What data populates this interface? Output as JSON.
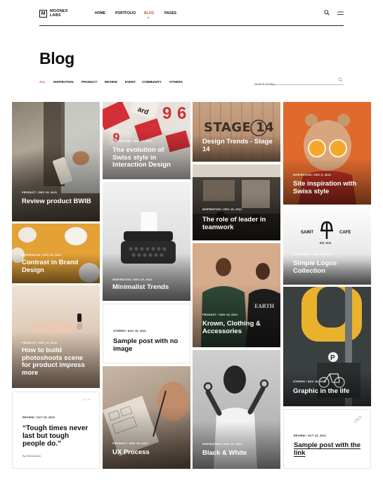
{
  "brand": {
    "name_line1": "MOONEX",
    "name_line2": "LABS",
    "mark": "M"
  },
  "nav": [
    {
      "label": "HOME"
    },
    {
      "label": "PORTFOLIO"
    },
    {
      "label": "BLOG",
      "active": true
    },
    {
      "label": "PAGES"
    }
  ],
  "page": {
    "title": "Blog"
  },
  "filters": [
    "ALL",
    "INSPIRATION",
    "PRODUCT",
    "REVIEW",
    "EVENT",
    "COMMUNITY",
    "OTHERS"
  ],
  "search": {
    "placeholder": "Search in blog"
  },
  "colors": {
    "accent": "#e14a2b"
  },
  "cards": [
    {
      "meta": "PRODUCT  /  DEC 15, 2021",
      "title": "Review product BWIB",
      "image": "hand-holding-product"
    },
    {
      "meta": "INSPIRATION  /  DEC 15, 2021",
      "title": "Contrast in Brand Design",
      "image": "pumpkins-on-orange"
    },
    {
      "meta": "PRODUCT  /  DEC 15, 2021",
      "title": "How to build photoshoots scene for product impress more",
      "image": "hand-with-bottle"
    },
    {
      "meta": "REVIEW  /  OCT 15, 2021",
      "title": "“Tough times never last but tough people do.”",
      "byline": "By Hendersion",
      "icon": "quote-icon"
    },
    {
      "meta": "INSPIRATION  /  DEC 13, 2021",
      "title": "The evolution of Swiss style in Interaction Design",
      "image": "swiss-cards"
    },
    {
      "meta": "INSPIRATION  /  DEC 15, 2021",
      "title": "Minimalist Trends",
      "image": "typewriter"
    },
    {
      "meta": "OTHERS  /  NOV 15, 2021",
      "title": "Sample post with no image"
    },
    {
      "meta": "PRODUCT  /  NOV 15, 2021",
      "title": "UX Process",
      "image": "sketching-wireframes"
    },
    {
      "meta": "",
      "title": "Design Trends - Stage 14",
      "image": "stage-14-sign",
      "sign": "STAGE 14"
    },
    {
      "meta": "INSPIRATION  /  DEC 15, 2021",
      "title": "The role of leader in teamwork",
      "image": "office-interior"
    },
    {
      "meta": "PRODUCT  /  NOV 15, 2021",
      "title": "Krown, Clothing & Accessories",
      "image": "two-men"
    },
    {
      "meta": "INSPIRATION  /  NOV 15, 2021",
      "title": "Black & White",
      "image": "woman-gesture"
    },
    {
      "meta": "INSPIRATION  /  DEC 3, 2021",
      "title": "Site inspiration with Swiss style",
      "image": "girl-with-oranges"
    },
    {
      "meta": "COMMUNITY  /  NOV 15, 2021",
      "title": "Simple Logos Collection",
      "image": "saint-cafe-sign",
      "sign_left": "SAINT",
      "sign_right": "CAFE",
      "sign_small": "EST. 2019"
    },
    {
      "meta": "OTHERS  /  NOV 15, 2021",
      "title": "Graphic in the life",
      "image": "parking-sign"
    },
    {
      "meta": "REVIEW  /  OCT 15, 2021",
      "title": "Sample post with the link",
      "icon": "link-icon"
    }
  ]
}
